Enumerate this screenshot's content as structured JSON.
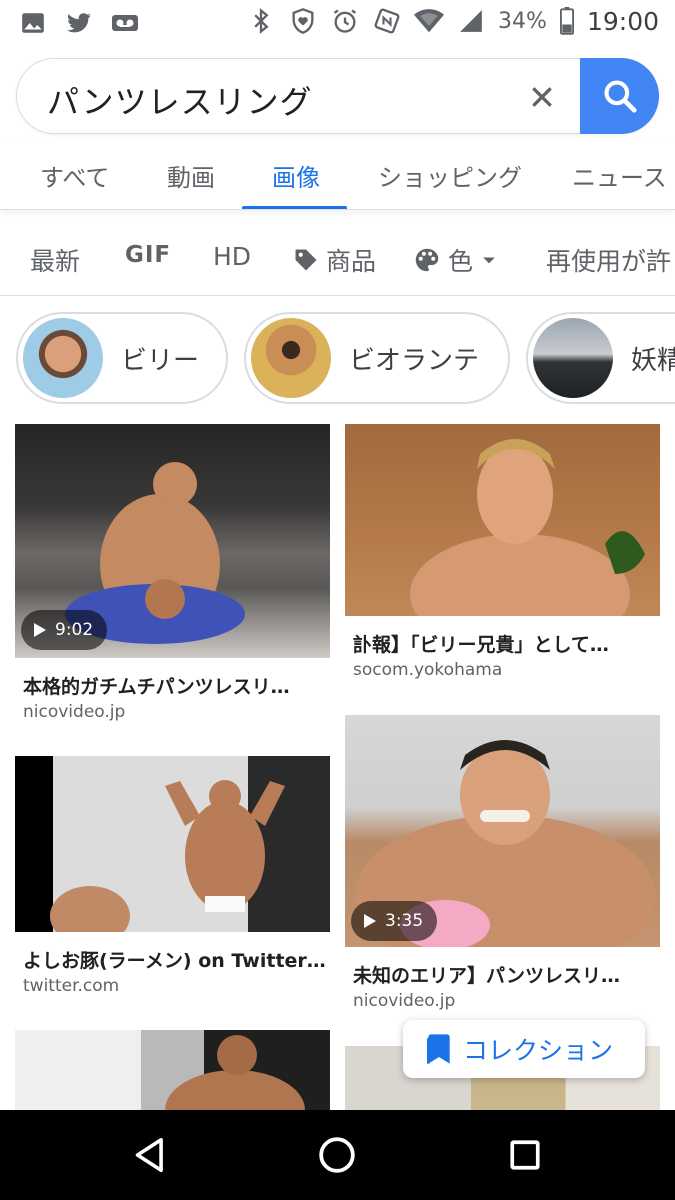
{
  "status_bar": {
    "battery": "34%",
    "time": "19:00",
    "icons": [
      "gallery-icon",
      "twitter-icon",
      "voicemail-icon",
      "bluetooth-icon",
      "heart-shield-icon",
      "alarm-icon",
      "nfc-icon",
      "wifi-icon",
      "signal-icon",
      "battery-icon"
    ]
  },
  "search": {
    "query": "パンツレスリング",
    "clear_icon": "close-icon",
    "search_icon": "search-icon",
    "accent": "#4285f4"
  },
  "tabs": [
    {
      "label": "すべて",
      "active": false
    },
    {
      "label": "動画",
      "active": false
    },
    {
      "label": "画像",
      "active": true
    },
    {
      "label": "ショッピング",
      "active": false
    },
    {
      "label": "ニュース",
      "active": false
    }
  ],
  "filters": [
    {
      "label": "最新"
    },
    {
      "label": "GIF"
    },
    {
      "label": "HD"
    },
    {
      "label": "商品",
      "icon": "tag-icon"
    },
    {
      "label": "色",
      "icon": "palette-icon"
    },
    {
      "label": "再使用が許"
    }
  ],
  "chips": [
    {
      "label": "ビリー"
    },
    {
      "label": "ビオランテ"
    },
    {
      "label": "妖精"
    }
  ],
  "results": {
    "left": [
      {
        "title": "本格的ガチムチパンツレスリ…",
        "source": "nicovideo.jp",
        "duration": "9:02"
      },
      {
        "title": "よしお豚(ラーメン) on Twitter…",
        "source": "twitter.com"
      }
    ],
    "right": [
      {
        "title": "訃報】「ビリー兄貴」として…",
        "source": "socom.yokohama"
      },
      {
        "title": "未知のエリア】パンツレスリ…",
        "source": "nicovideo.jp",
        "duration": "3:35"
      }
    ]
  },
  "collection": {
    "label": "コレクション",
    "icon": "bookmark-icon",
    "color": "#1a73e8"
  },
  "nav": {
    "buttons": [
      "back-icon",
      "home-icon",
      "recents-icon"
    ]
  }
}
